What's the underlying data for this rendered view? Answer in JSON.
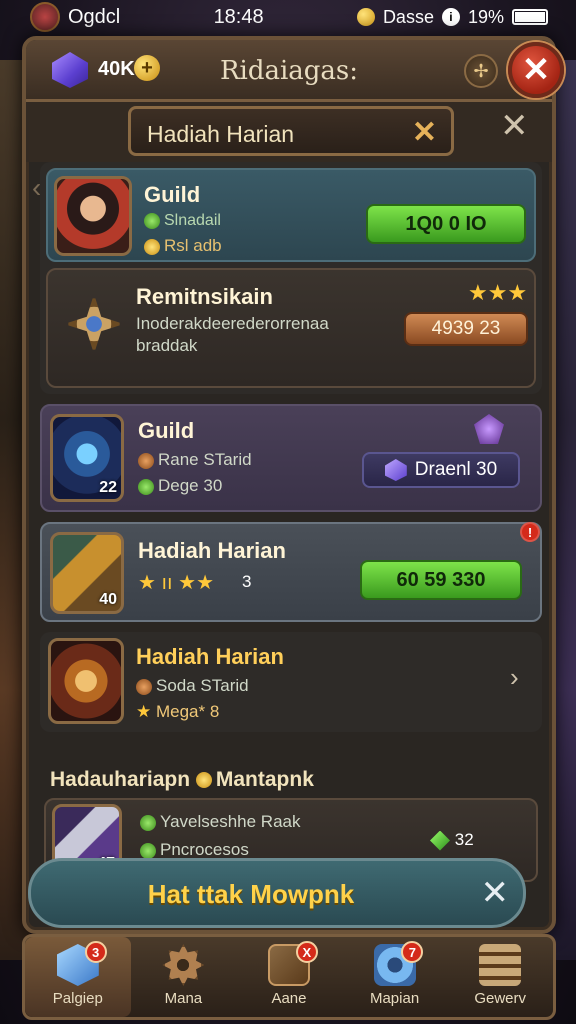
{
  "status": {
    "carrier": "Ogdcl",
    "time": "18:48",
    "network": "Dasse",
    "battery": "19%"
  },
  "header": {
    "resource_amount": "40K",
    "title": "Ridaiagas:",
    "settings_symbol": "✢",
    "close_symbol": "✕"
  },
  "subtab": {
    "label": "Hadiah Harian",
    "tab_close": "✕",
    "dismiss": "✕"
  },
  "cards": [
    {
      "name": "Guild",
      "line1": "Slnadail",
      "line2": "Rsl adb",
      "button": "1Q0 0 IO"
    },
    {
      "name": "Remitnsikain",
      "line1": "Inoderakdeerederorrenaa",
      "line2": "braddak",
      "stars": "★★★",
      "button": "4939 23"
    },
    {
      "name": "Guild",
      "level": "22",
      "line1": "Rane STarid",
      "line2": "Dege 30",
      "button": "Draenl  30"
    },
    {
      "name": "Hadiah Harian",
      "level": "40",
      "stars": "★ ıı ★★",
      "stars_count": "3",
      "button": "60 59 330",
      "badge": "!"
    },
    {
      "name": "Hadiah Harian",
      "line1": "Soda STarid",
      "line2": "Mega* 8",
      "chevron": "›"
    }
  ],
  "section": {
    "title": "Hadauhariapn",
    "subtitle": "Mantapnk"
  },
  "section_card": {
    "level": "47",
    "line1": "Yavelseshhe Raak",
    "line2": "Pncrocesos",
    "reward": "32"
  },
  "action": {
    "label": "Hat ttak Mowpnk",
    "close": "✕"
  },
  "nav": [
    {
      "label": "Palgiep",
      "badge": "3"
    },
    {
      "label": "Mana",
      "badge": ""
    },
    {
      "label": "Aane",
      "badge": "X"
    },
    {
      "label": "Mapian",
      "badge": "7"
    },
    {
      "label": "Gewerv",
      "badge": ""
    }
  ]
}
